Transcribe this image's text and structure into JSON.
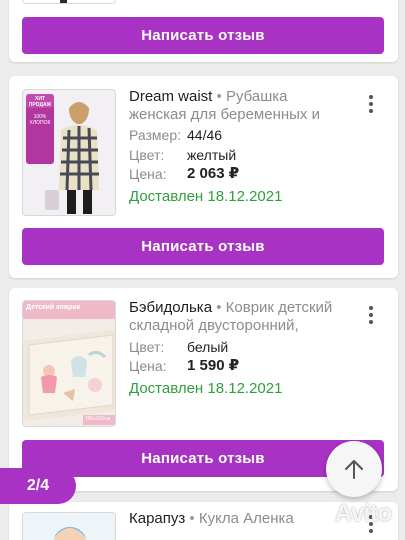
{
  "write_review_label": "Написать отзыв",
  "orders": [
    {
      "brand": "Dream waist",
      "separator": " • ",
      "description": "Рубашка женская для беременных и кормящих",
      "size_label": "Размер:",
      "size_value": "44/46",
      "color_label": "Цвет:",
      "color_value": "желтый",
      "price_label": "Цена:",
      "price_value": "2 063 ₽",
      "status": "Доставлен 18.12.2021",
      "thumb_badges": [
        "ХИТ ПРОДАЖ",
        "100% ХЛОПОК"
      ]
    },
    {
      "brand": "Бэбидолька",
      "separator": " • ",
      "description": "Коврик детский складной двусторонний,",
      "color_label": "Цвет:",
      "color_value": "белый",
      "price_label": "Цена:",
      "price_value": "1 590 ₽",
      "status": "Доставлен 18.12.2021",
      "thumb_top_label": "Детский коврик",
      "thumb_size_label": "180x200см"
    },
    {
      "brand": "Карапуз",
      "separator": " • ",
      "description": "Кукла Аленка"
    }
  ],
  "pager": {
    "text": "2/4"
  },
  "watermark": {
    "text": "Avito"
  },
  "colors": {
    "accent": "#a832c3",
    "status_green": "#2e9e3e",
    "background": "#ececec"
  },
  "icons": {
    "menu": "kebab-menu-icon",
    "scroll_top": "arrow-up-icon",
    "watermark": "avito-logo-icon"
  }
}
